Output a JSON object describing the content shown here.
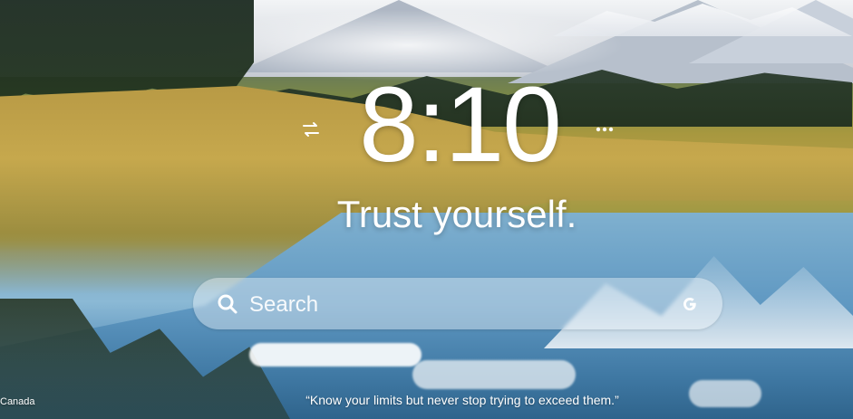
{
  "clock": {
    "time": "8:10"
  },
  "focus": {
    "text": "Trust yourself."
  },
  "search": {
    "placeholder": "Search",
    "engine_icon": "google-g-icon"
  },
  "quote": {
    "text": "“Know your limits but never stop trying to exceed them.”"
  },
  "photo": {
    "location": "Canada"
  },
  "icons": {
    "switch": "switch-arrows-icon",
    "more": "more-dots-icon",
    "search": "search-icon"
  },
  "colors": {
    "text": "#ffffff"
  }
}
